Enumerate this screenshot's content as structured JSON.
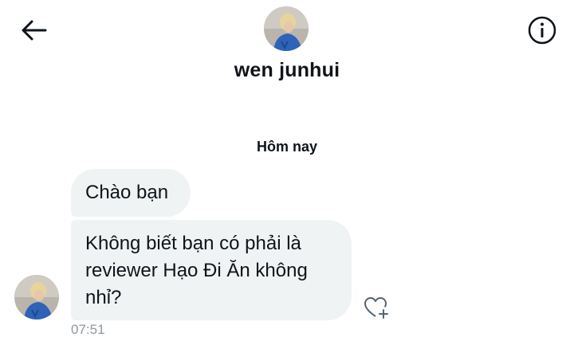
{
  "header": {
    "back_icon": "arrow-left-icon",
    "info_icon": "info-circle-icon",
    "contact_name": "wen junhui"
  },
  "conversation": {
    "date_label": "Hôm nay",
    "messages": [
      {
        "text": "Chào bạn"
      },
      {
        "text": "Không biết bạn có phải là reviewer Hạo Đi Ăn không nhỉ?"
      }
    ],
    "timestamp": "07:51",
    "react_icon": "heart-plus-icon"
  },
  "colors": {
    "bubble_bg": "#eff3f4",
    "text": "#0f1419",
    "muted": "#8c979f"
  }
}
